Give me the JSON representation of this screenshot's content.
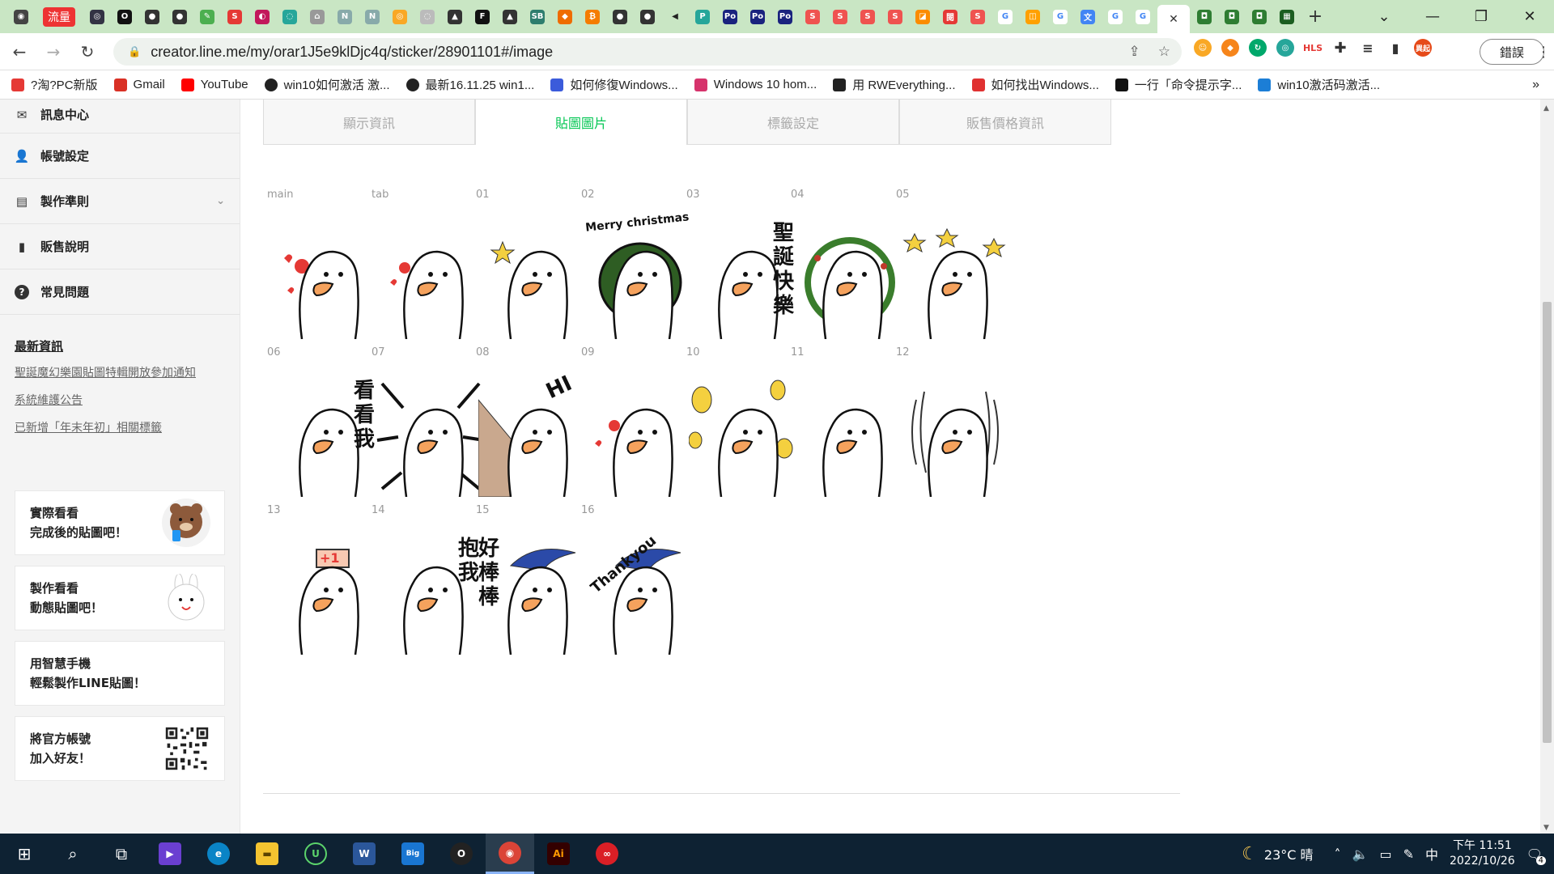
{
  "browser": {
    "traffic_tab_label": "流量",
    "url": "creator.line.me/my/orar1J5e9klDjc4q/sticker/28901101#/image",
    "profile_label": "異起",
    "error_button": "錯誤",
    "new_tab": "+",
    "window_controls": [
      "⌄",
      "—",
      "❐",
      "✕"
    ]
  },
  "bookmarks": [
    {
      "label": "?淘?PC新版",
      "color": "#e53935"
    },
    {
      "label": "Gmail",
      "color": "#d93025"
    },
    {
      "label": "YouTube",
      "color": "#ff0000"
    },
    {
      "label": "win10如何激活 激...",
      "color": "#222222"
    },
    {
      "label": "最新16.11.25 win1...",
      "color": "#222222"
    },
    {
      "label": "如何修復Windows...",
      "color": "#3b5bdb"
    },
    {
      "label": "Windows 10 hom...",
      "color": "#d6336c"
    },
    {
      "label": "用 RWEverything...",
      "color": "#222222"
    },
    {
      "label": "如何找出Windows...",
      "color": "#e03131"
    },
    {
      "label": "一行「命令提示字...",
      "color": "#111111"
    },
    {
      "label": "win10激活码激活...",
      "color": "#1c7ed6"
    }
  ],
  "sidebar": {
    "items": [
      {
        "label": "訊息中心",
        "icon": "✉"
      },
      {
        "label": "帳號設定",
        "icon": "👤"
      },
      {
        "label": "製作準則",
        "icon": "▤",
        "chevron": "⌄"
      },
      {
        "label": "販售說明",
        "icon": "▮"
      },
      {
        "label": "常見問題",
        "icon": "?"
      }
    ],
    "news_title": "最新資訊",
    "news": [
      "聖誕魔幻樂園貼圖特輯開放參加通知",
      "系統維護公告",
      "已新增「年末年初」相關標籤"
    ],
    "promos": [
      {
        "line1": "實際看看",
        "line2": "完成後的貼圖吧！",
        "color": "#8d5a3b"
      },
      {
        "line1": "製作看看",
        "line2": "動態貼圖吧！",
        "color": "#f1f1f1"
      },
      {
        "line1": "用智慧手機",
        "line2": "輕鬆製作LINE貼圖！",
        "color": ""
      },
      {
        "line1": "將官方帳號",
        "line2": "加入好友！",
        "color": "#222222"
      }
    ]
  },
  "main": {
    "tabs": [
      "顯示資訊",
      "貼圖圖片",
      "標籤設定",
      "販售價格資訊"
    ],
    "active_tab": 1,
    "stickers": [
      {
        "label": "main",
        "text": ""
      },
      {
        "label": "tab",
        "text": ""
      },
      {
        "label": "01",
        "text": ""
      },
      {
        "label": "02",
        "text": "Merry christmas"
      },
      {
        "label": "03",
        "text": "聖誕快樂"
      },
      {
        "label": "04",
        "text": ""
      },
      {
        "label": "05",
        "text": ""
      },
      {
        "label": "06",
        "text": "看看我"
      },
      {
        "label": "07",
        "text": ""
      },
      {
        "label": "08",
        "text": "HI"
      },
      {
        "label": "09",
        "text": ""
      },
      {
        "label": "10",
        "text": ""
      },
      {
        "label": "11",
        "text": ""
      },
      {
        "label": "12",
        "text": ""
      },
      {
        "label": "13",
        "text": "+1"
      },
      {
        "label": "14",
        "text": "抱我"
      },
      {
        "label": "15",
        "text": "好棒棒"
      },
      {
        "label": "16",
        "text": "Thankyou"
      }
    ]
  },
  "taskbar": {
    "weather": "23°C 晴",
    "ime": "中",
    "time": "下午 11:51",
    "date": "2022/10/26",
    "notifications": "4"
  }
}
